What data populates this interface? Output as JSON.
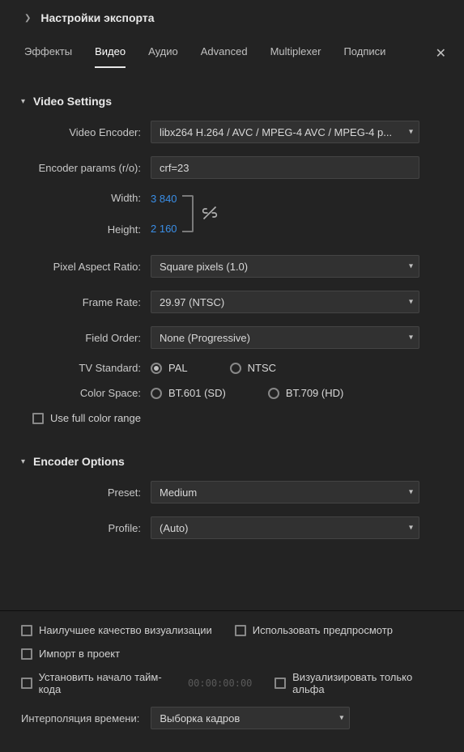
{
  "header": {
    "title": "Настройки экспорта"
  },
  "tabs": {
    "items": [
      "Эффекты",
      "Видео",
      "Аудио",
      "Advanced",
      "Multiplexer",
      "Подписи"
    ],
    "active_index": 1
  },
  "video_settings": {
    "title": "Video Settings",
    "encoder_label": "Video Encoder:",
    "encoder_value": "libx264 H.264 / AVC / MPEG-4 AVC / MPEG-4 p...",
    "params_label": "Encoder params (r/o):",
    "params_value": "crf=23",
    "width_label": "Width:",
    "width_value": "3 840",
    "height_label": "Height:",
    "height_value": "2 160",
    "par_label": "Pixel Aspect Ratio:",
    "par_value": "Square pixels (1.0)",
    "fr_label": "Frame Rate:",
    "fr_value": "29.97 (NTSC)",
    "fo_label": "Field Order:",
    "fo_value": "None (Progressive)",
    "tv_label": "TV Standard:",
    "tv_pal": "PAL",
    "tv_ntsc": "NTSC",
    "cs_label": "Color Space:",
    "cs_601": "BT.601 (SD)",
    "cs_709": "BT.709 (HD)",
    "full_range": "Use full color range"
  },
  "encoder_options": {
    "title": "Encoder Options",
    "preset_label": "Preset:",
    "preset_value": "Medium",
    "profile_label": "Profile:",
    "profile_value": "(Auto)"
  },
  "footer": {
    "max_quality": "Наилучшее качество визуализации",
    "use_preview": "Использовать предпросмотр",
    "import_project": "Импорт в проект",
    "set_start_tc": "Установить начало тайм-кода",
    "timecode": "00:00:00:00",
    "render_alpha": "Визуализировать только альфа",
    "interp_label": "Интерполяция времени:",
    "interp_value": "Выборка кадров"
  }
}
